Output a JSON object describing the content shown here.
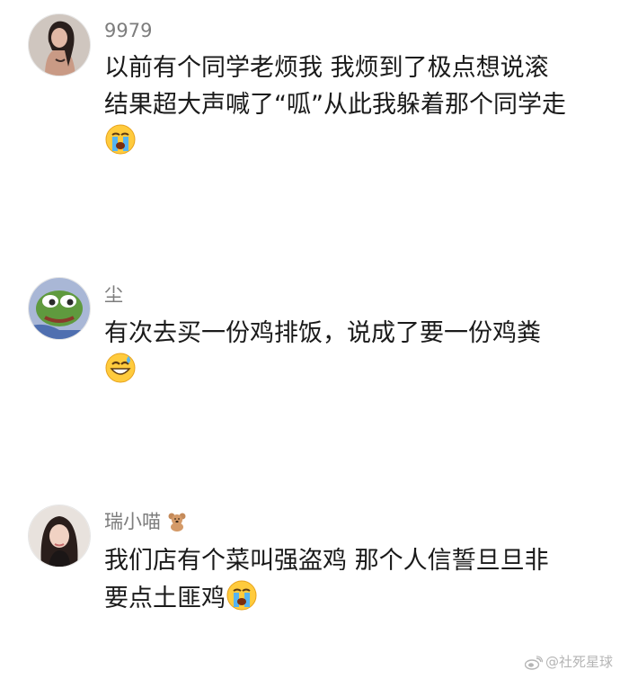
{
  "comments": [
    {
      "username": "9979",
      "lines": [
        "以前有个同学老烦我 我烦到了极点想说滚",
        "结果超大声喊了“呱”从此我躲着那个同学走"
      ],
      "trailing_emoji": "loudly-crying-face"
    },
    {
      "username": "尘",
      "lines": [
        "有次去买一份鸡排饭，说成了要一份鸡粪"
      ],
      "trailing_emoji": "grinning-sweat-face"
    },
    {
      "username": "瑞小喵",
      "username_badge": "teddy-bear-emoji",
      "lines": [
        "我们店有个菜叫强盗鸡 那个人信誓旦旦非",
        "要点土匪鸡"
      ],
      "trailing_emoji": "loudly-crying-face"
    }
  ],
  "watermark": {
    "text": "@社死星球",
    "icon": "weibo-logo-icon"
  },
  "colors": {
    "background": "#ffffff",
    "username": "#7d7d7d",
    "body_text": "#1a1a1a",
    "watermark": "#b5b5b5"
  }
}
